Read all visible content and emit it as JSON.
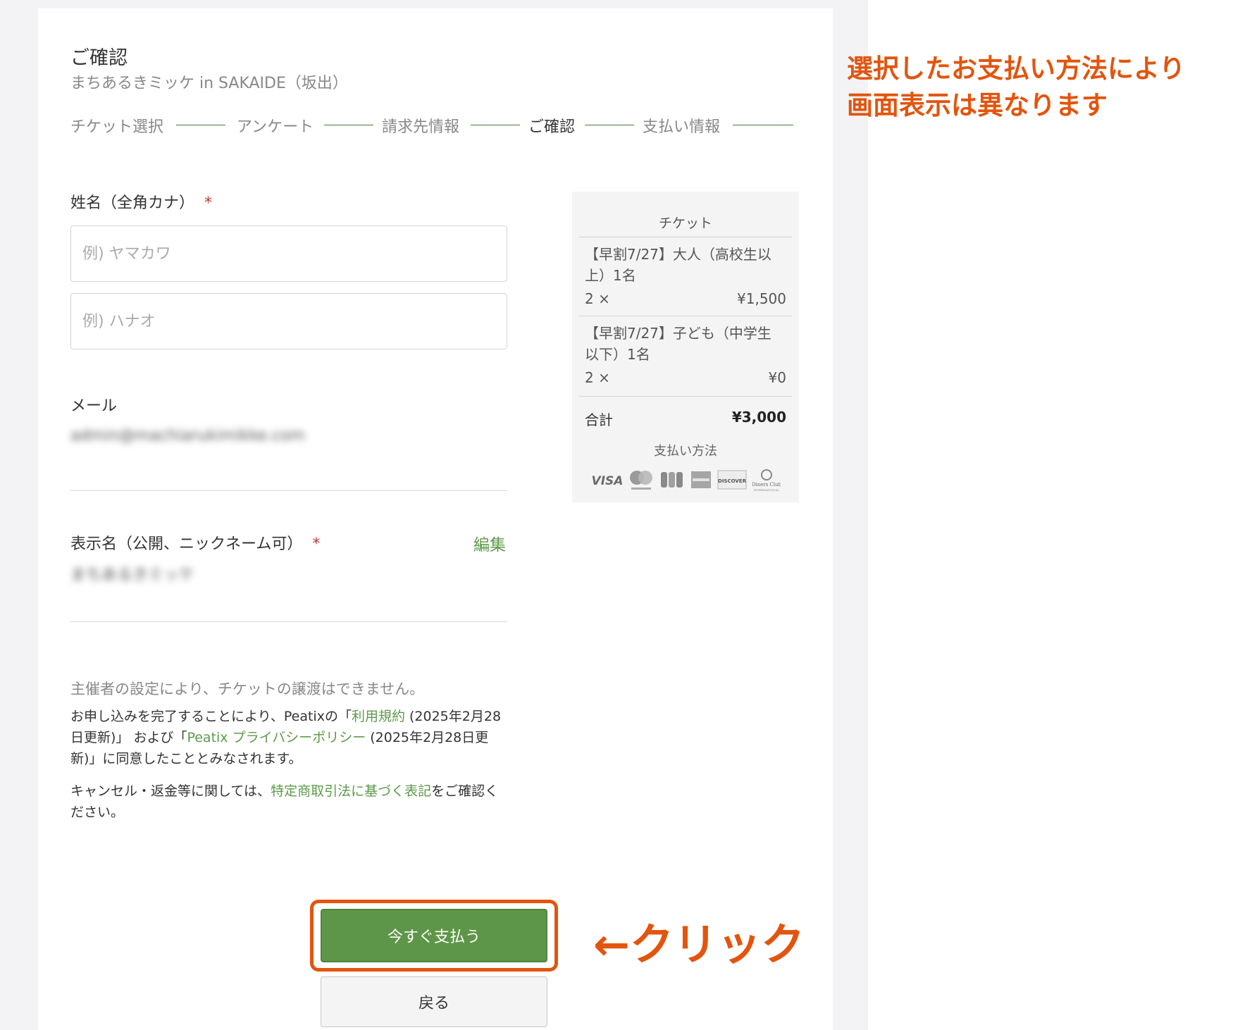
{
  "page": {
    "title": "ご確認",
    "event_name": "まちあるきミッケ in SAKAIDE（坂出）"
  },
  "steps": [
    "チケット選択",
    "アンケート",
    "請求先情報",
    "ご確認",
    "支払い情報"
  ],
  "form": {
    "name_label": "姓名（全角カナ）",
    "required_mark": "*",
    "last_name_placeholder": "例) ヤマカワ",
    "first_name_placeholder": "例) ハナオ",
    "email_label": "メール",
    "email_value": "admin@machiarukimikke.com",
    "display_name_label": "表示名（公開、ニックネーム可）",
    "display_name_value": "まちあるきミッケ",
    "edit_label": "編集"
  },
  "notices": {
    "no_transfer": "主催者の設定により、チケットの譲渡はできません。",
    "agree_pre": "お申し込みを完了することにより、Peatixの「",
    "terms_link": "利用規約",
    "agree_mid1": " (2025年2月28日更新)」 および「",
    "privacy_link": "Peatix プライバシーポリシー",
    "agree_post": " (2025年2月28日更新)」に同意したこととみなされます。",
    "cancel_pre": "キャンセル・返金等に関しては、",
    "tokusho_link": "特定商取引法に基づく表記",
    "cancel_post": "をご確認ください。"
  },
  "summary": {
    "heading": "チケット",
    "items": [
      {
        "name": "【早割7/27】大人（高校生以上）1名",
        "qty": "2 ×",
        "price": "¥1,500"
      },
      {
        "name": "【早割7/27】子ども（中学生以下）1名",
        "qty": "2 ×",
        "price": "¥0"
      }
    ],
    "total_label": "合計",
    "total_value": "¥3,000",
    "payment_heading": "支払い方法",
    "card_brands": [
      "VISA",
      "mastercard",
      "JCB",
      "AMEX",
      "DISCOVER",
      "Diners Club International"
    ]
  },
  "buttons": {
    "pay_now": "今すぐ支払う",
    "back": "戻る"
  },
  "annotations": {
    "note_line1": "選択したお支払い方法により",
    "note_line2": "画面表示は異なります",
    "click": "←クリック"
  },
  "colors": {
    "accent_green": "#5d9648",
    "annotation_orange": "#e3540d"
  }
}
